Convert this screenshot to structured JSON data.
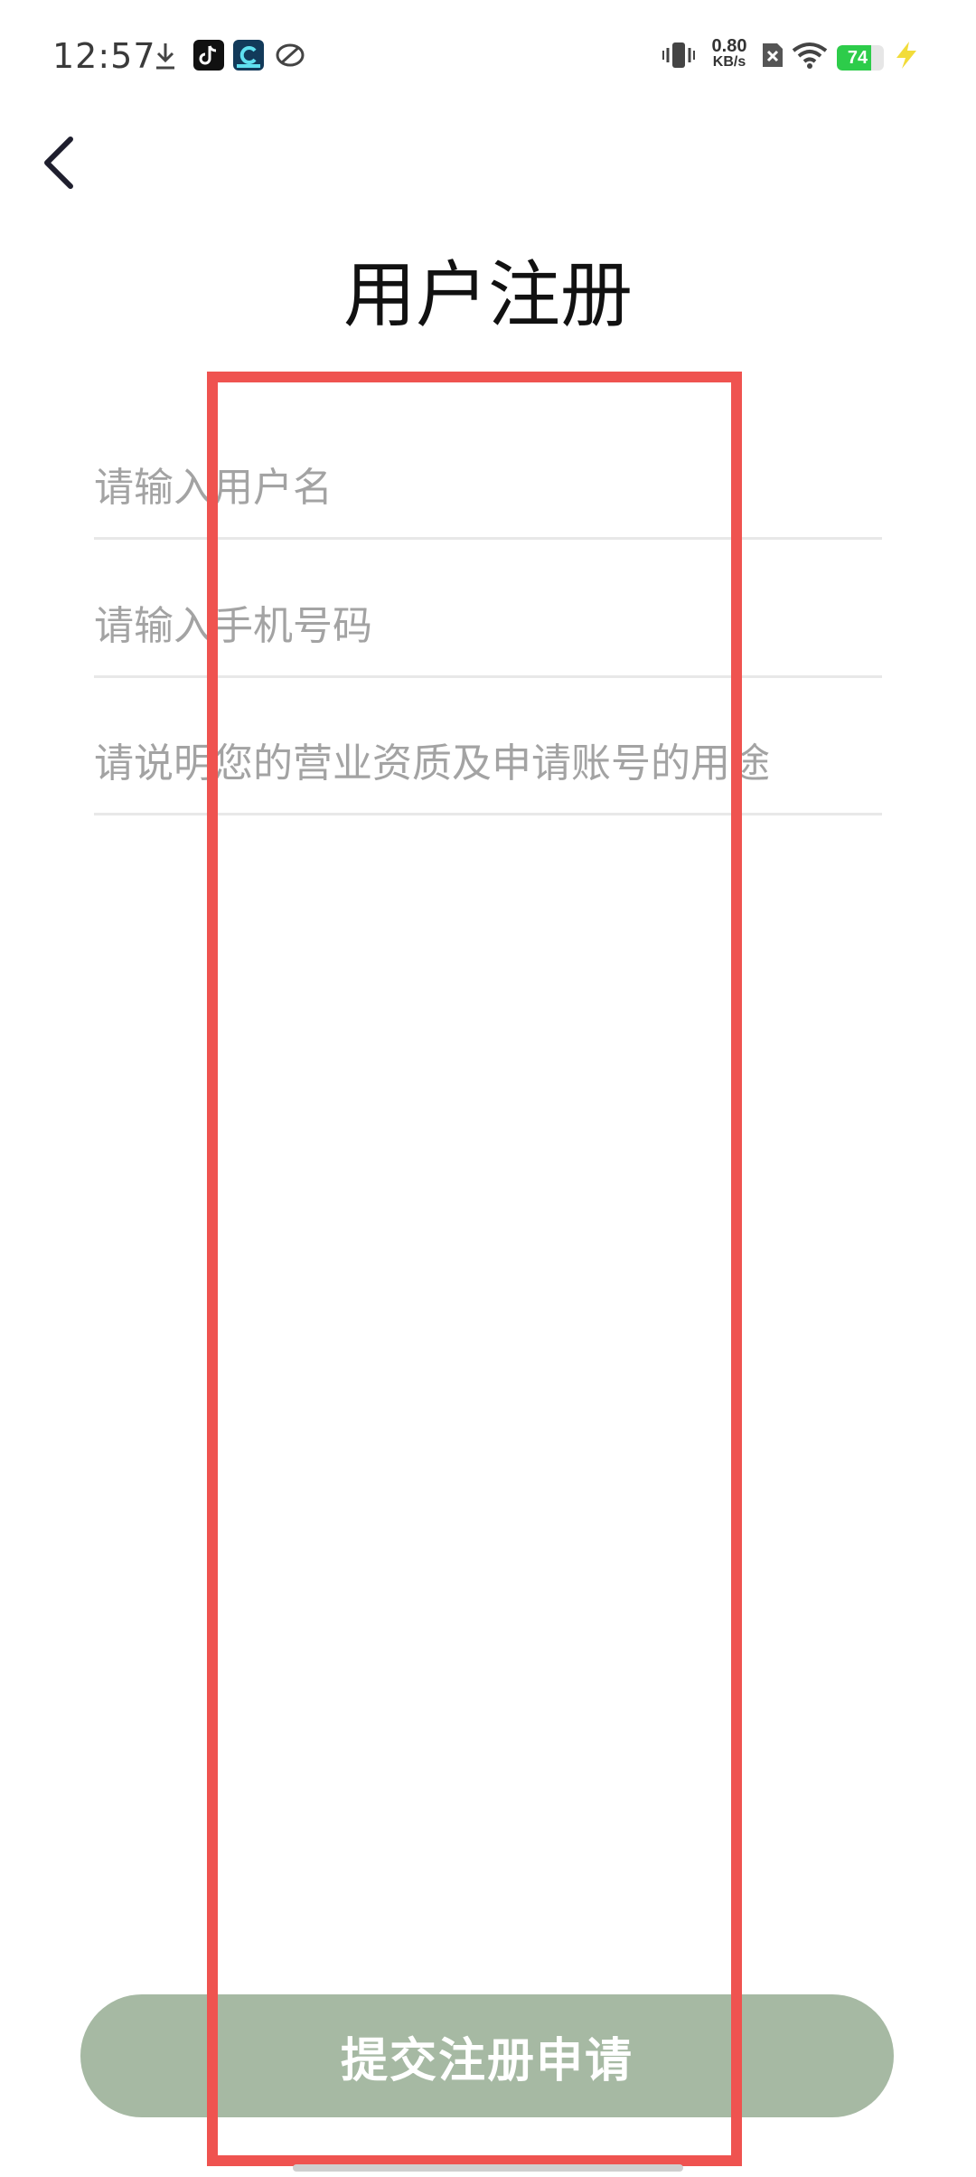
{
  "status_bar": {
    "time": "12:57",
    "net_speed_value": "0.80",
    "net_speed_unit": "KB/s",
    "battery_level": "74",
    "icons": [
      "download-icon",
      "tiktok-icon",
      "app-icon",
      "sync-icon",
      "vibrate-icon",
      "no-sim-icon",
      "wifi-icon",
      "battery-icon",
      "charging-icon"
    ]
  },
  "header": {
    "back_icon": "chevron-left-icon",
    "title": "用户注册"
  },
  "form": {
    "username_placeholder": "请输入用户名",
    "phone_placeholder": "请输入手机号码",
    "purpose_placeholder": "请说明您的营业资质及申请账号的用途"
  },
  "submit_label": "提交注册申请",
  "colors": {
    "accent": "#a6b9a3",
    "highlight": "#ef5350",
    "battery": "#2dcc4a"
  }
}
